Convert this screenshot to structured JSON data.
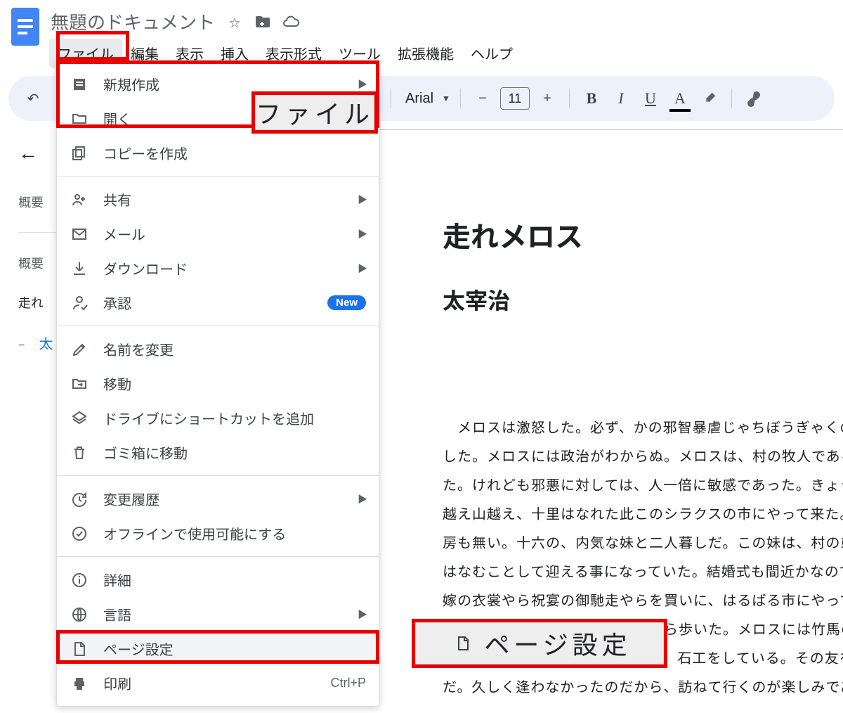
{
  "header": {
    "docTitle": "無題のドキュメント",
    "menus": [
      "ファイル",
      "編集",
      "表示",
      "挿入",
      "表示形式",
      "ツール",
      "拡張機能",
      "ヘルプ"
    ]
  },
  "toolbar": {
    "font": "Arial",
    "fontSize": "11"
  },
  "sidepanel": {
    "tab1": "概要",
    "tab2": "概要",
    "item1": "走れ",
    "item2": "太"
  },
  "doc": {
    "h1": "走れメロス",
    "h2": "太宰治",
    "p": "　メロスは激怒した。必ず、かの邪智暴虐じゃちぼうぎゃくの王を除かなければならぬと決意した。メロスには政治がわからぬ。メロスは、村の牧人である。笛を吹き、羊と遊んで暮して来た。けれども邪悪に対しては、人一倍に敏感であった。きょう未明メロスは村を出発し、野を越え山越え、十里はなれた此このシラクスの市にやって来た。メロスには父も、母も無い。女房も無い。十六の、内気な妹と二人暮しだ。この妹は、村の或る律気な一牧人を、近々、花婿はなむことして迎える事になっていた。結婚式も間近かなのである。メロスは、それゆえ、花嫁の衣裳やら祝宴の御馳走やらを買いに、はるばる市にやって来たのだ。先ず、その品々を買い集め、それから都の大路をぶらぶら歩いた。メロスには竹馬の友があった。セリヌンティウスである。今は此のシラクスの市で、石工をしている。その友を、これから訪ねてみるつもりなのだ。久しく逢わなかったのだから、訪ねて行くのが楽しみである。"
  },
  "fileMenu": {
    "new": "新規作成",
    "open": "開く",
    "copy": "コピーを作成",
    "share": "共有",
    "mail": "メール",
    "download": "ダウンロード",
    "approve": "承認",
    "approveBadge": "New",
    "rename": "名前を変更",
    "move": "移動",
    "shortcut": "ドライブにショートカットを追加",
    "trash": "ゴミ箱に移動",
    "history": "変更履歴",
    "offline": "オフラインで使用可能にする",
    "details": "詳細",
    "language": "言語",
    "pageSetup": "ページ設定",
    "print": "印刷",
    "printKey": "Ctrl+P"
  },
  "callouts": {
    "file": "ファイル",
    "pageSetup": "ページ設定"
  }
}
